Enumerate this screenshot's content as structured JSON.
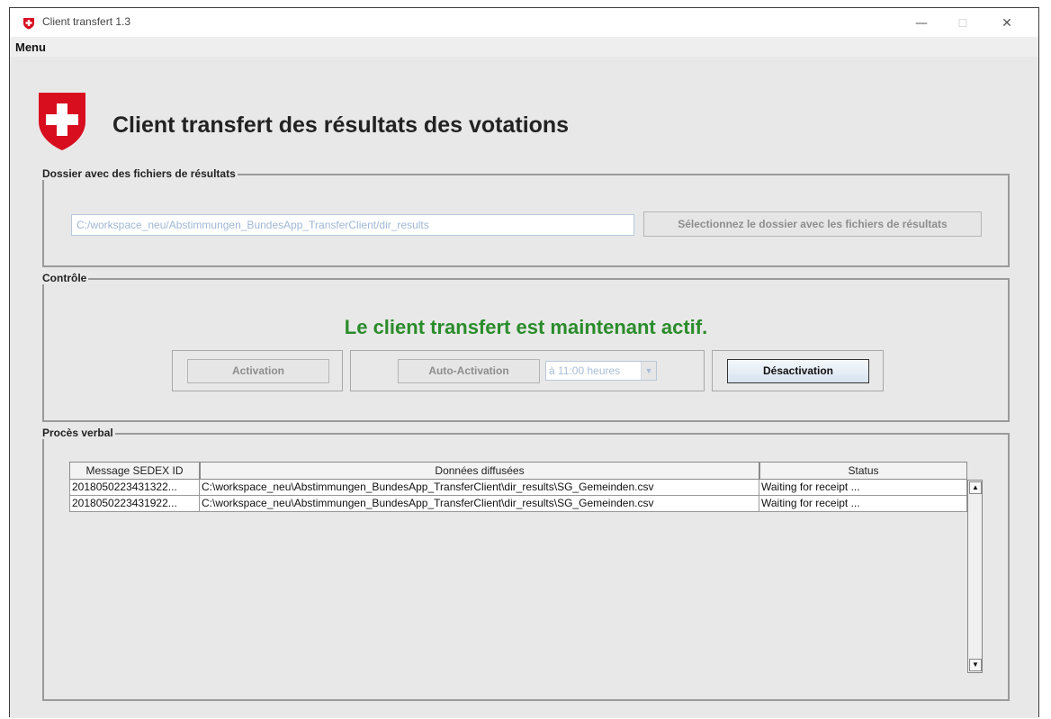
{
  "window": {
    "title": "Client transfert 1.3",
    "minimize_glyph": "—",
    "maximize_glyph": "☐",
    "close_glyph": "✕"
  },
  "menu": {
    "label": "Menu"
  },
  "app": {
    "title": "Client transfert des résultats des votations",
    "logo_icon": "swiss-shield-icon",
    "brand_color": "#d80e1f"
  },
  "folder_group": {
    "title": "Dossier avec des fichiers de résultats",
    "path_value": "C:/workspace_neu/Abstimmungen_BundesApp_TransferClient/dir_results",
    "select_button": "Sélectionnez le dossier avec les fichiers de résultats"
  },
  "control_group": {
    "title": "Contrôle",
    "status_message": "Le client transfert est maintenant actif.",
    "status_color": "#2a8c2a",
    "activation_button": "Activation",
    "auto_activation_button": "Auto-Activation",
    "time_select": "à 11:00 heures",
    "deactivation_button": "Désactivation"
  },
  "log_group": {
    "title": "Procès verbal",
    "columns": [
      "Message SEDEX ID",
      "Données diffusées",
      "Status"
    ],
    "rows": [
      [
        "2018050223431322...",
        "C:\\workspace_neu\\Abstimmungen_BundesApp_TransferClient\\dir_results\\SG_Gemeinden.csv",
        "Waiting for receipt ..."
      ],
      [
        "2018050223431922...",
        "C:\\workspace_neu\\Abstimmungen_BundesApp_TransferClient\\dir_results\\SG_Gemeinden.csv",
        "Waiting for receipt ..."
      ]
    ],
    "scroll_up_icon": "arrow-up-icon",
    "scroll_down_icon": "arrow-down-icon"
  }
}
